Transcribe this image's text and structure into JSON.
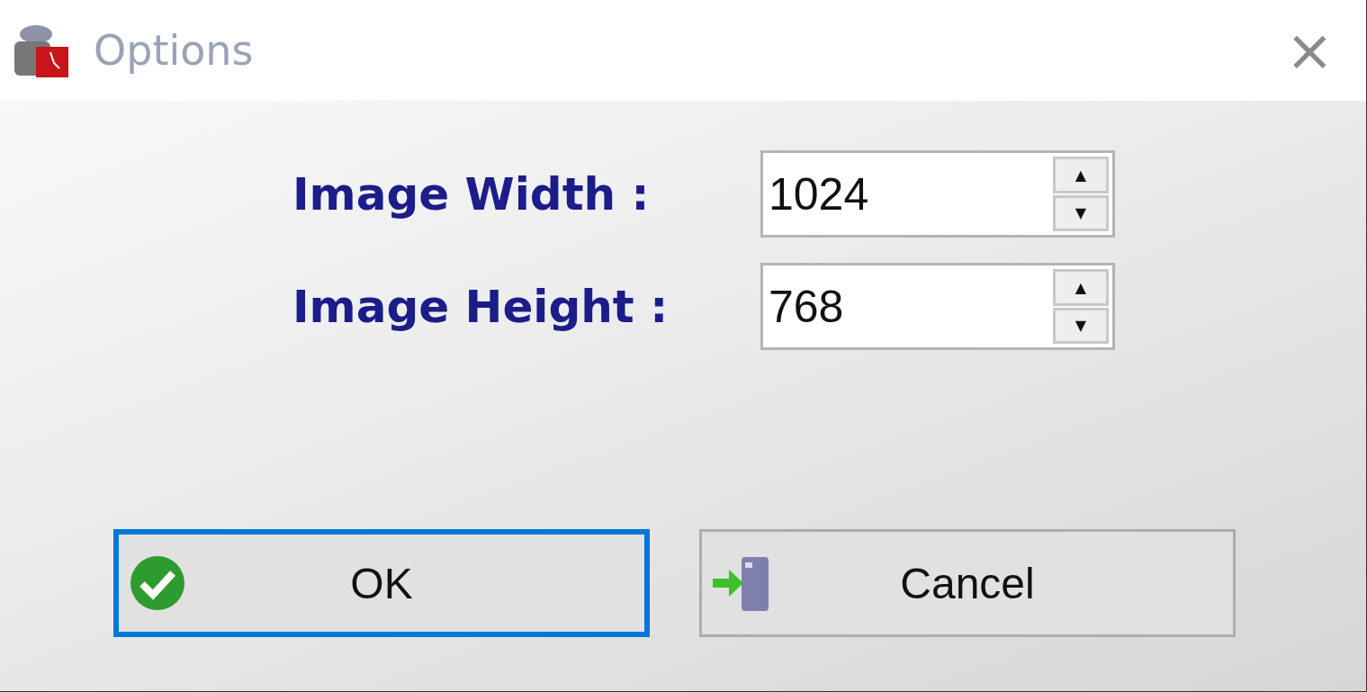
{
  "window": {
    "title": "Options",
    "close": "×"
  },
  "fields": [
    {
      "label": "Image Width :",
      "value": "1024",
      "up": "▲",
      "down": "▼"
    },
    {
      "label": "Image Height :",
      "value": "768",
      "up": "▲",
      "down": "▼"
    }
  ],
  "buttons": [
    {
      "kind": "ok",
      "label": "OK",
      "focused": true
    },
    {
      "kind": "cancel",
      "label": "Cancel",
      "focused": false
    }
  ]
}
